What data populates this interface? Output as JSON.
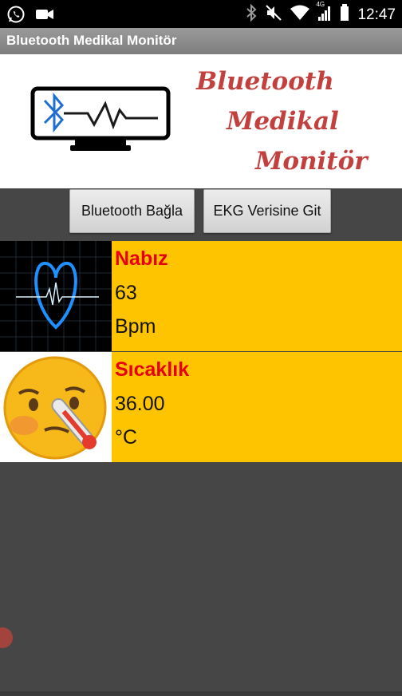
{
  "status_bar": {
    "time": "12:47",
    "network": "4G",
    "icons": [
      "whatsapp-icon",
      "video-camera-icon",
      "bluetooth-icon",
      "mute-icon",
      "wifi-icon",
      "signal-icon",
      "battery-icon"
    ]
  },
  "app": {
    "title": "Bluetooth Medikal Monitör"
  },
  "banner": {
    "line1": "Bluetooth",
    "line2": "Medikal",
    "line3": "Monitör"
  },
  "buttons": {
    "bluetooth_connect": "Bluetooth Bağla",
    "ekg_data": "EKG Verisine Git"
  },
  "pulse": {
    "label": "Nabız",
    "value": "63",
    "unit": "Bpm"
  },
  "temperature": {
    "label": "Sıcaklık",
    "value": "36.00",
    "unit": "°C"
  },
  "colors": {
    "panel_bg": "#ffc400",
    "label_red": "#e60012",
    "banner_text": "#c2403d",
    "background": "#464646"
  }
}
